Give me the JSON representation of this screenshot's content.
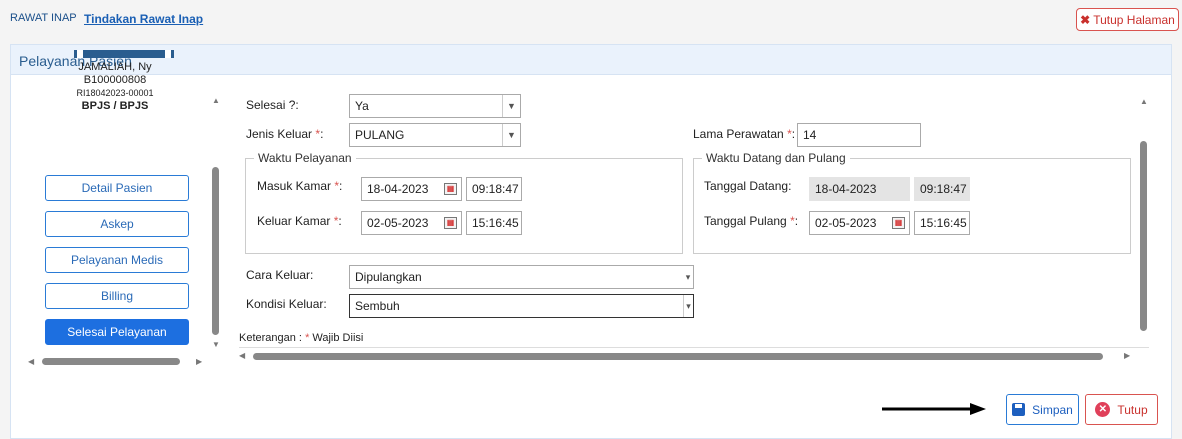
{
  "breadcrumb": {
    "module": "RAWAT INAP",
    "page": "Tindakan Rawat Inap"
  },
  "header": {
    "close_page_label": "Tutup Halaman"
  },
  "panel": {
    "title": "Pelayanan Pasien"
  },
  "patient": {
    "name": "JAMALIAH, Ny",
    "rm_number": "B100000808",
    "reg_number": "RI18042023-00001",
    "payer": "BPJS / BPJS"
  },
  "nav": {
    "items": [
      {
        "label": "Detail Pasien",
        "active": false
      },
      {
        "label": "Askep",
        "active": false
      },
      {
        "label": "Pelayanan Medis",
        "active": false
      },
      {
        "label": "Billing",
        "active": false
      },
      {
        "label": "Selesai Pelayanan",
        "active": true
      }
    ]
  },
  "form": {
    "selesai": {
      "label": "Selesai ?:",
      "value": "Ya"
    },
    "jenis_keluar": {
      "label": "Jenis Keluar",
      "value": "PULANG"
    },
    "lama_perawatan": {
      "label": "Lama Perawatan",
      "value": "14"
    },
    "waktu_pelayanan": {
      "legend": "Waktu Pelayanan",
      "masuk_label": "Masuk Kamar",
      "masuk_date": "18-04-2023",
      "masuk_time": "09:18:47",
      "keluar_label": "Keluar Kamar",
      "keluar_date": "02-05-2023",
      "keluar_time": "15:16:45"
    },
    "waktu_datang": {
      "legend": "Waktu Datang dan Pulang",
      "datang_label": "Tanggal Datang:",
      "datang_date": "18-04-2023",
      "datang_time": "09:18:47",
      "pulang_label": "Tanggal Pulang",
      "pulang_date": "02-05-2023",
      "pulang_time": "15:16:45"
    },
    "cara_keluar": {
      "label": "Cara Keluar:",
      "value": "Dipulangkan"
    },
    "kondisi_keluar": {
      "label": "Kondisi Keluar:",
      "value": "Sembuh"
    },
    "note": {
      "prefix": "Keterangan : ",
      "required_mark": "*",
      "text": " Wajib Diisi"
    }
  },
  "actions": {
    "save_label": "Simpan",
    "close_label": "Tutup"
  },
  "colors": {
    "primary": "#1d6fe0",
    "danger": "#d9534f",
    "panel_head": "#eaf2fc"
  },
  "icons": {
    "save": "floppy-disk-icon",
    "close": "close-circle-icon",
    "close_page": "x-icon",
    "calendar": "calendar-icon"
  }
}
